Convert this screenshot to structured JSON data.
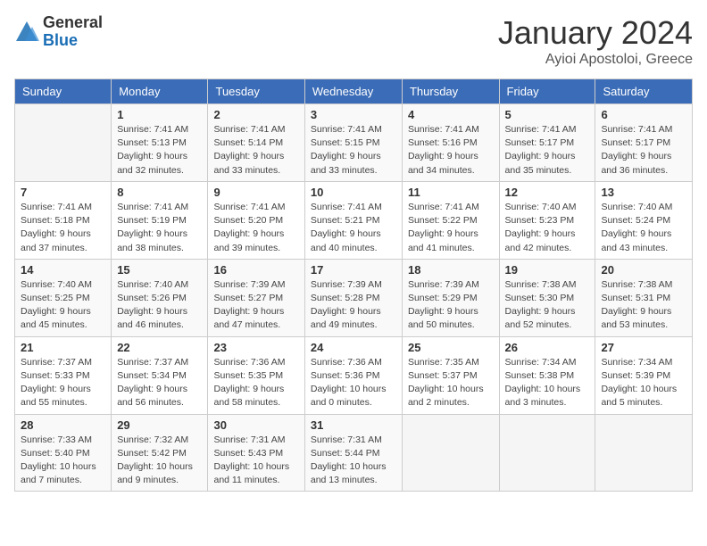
{
  "header": {
    "logo_general": "General",
    "logo_blue": "Blue",
    "title": "January 2024",
    "subtitle": "Ayioi Apostoloi, Greece"
  },
  "days_of_week": [
    "Sunday",
    "Monday",
    "Tuesday",
    "Wednesday",
    "Thursday",
    "Friday",
    "Saturday"
  ],
  "weeks": [
    [
      {
        "num": "",
        "info": ""
      },
      {
        "num": "1",
        "info": "Sunrise: 7:41 AM\nSunset: 5:13 PM\nDaylight: 9 hours\nand 32 minutes."
      },
      {
        "num": "2",
        "info": "Sunrise: 7:41 AM\nSunset: 5:14 PM\nDaylight: 9 hours\nand 33 minutes."
      },
      {
        "num": "3",
        "info": "Sunrise: 7:41 AM\nSunset: 5:15 PM\nDaylight: 9 hours\nand 33 minutes."
      },
      {
        "num": "4",
        "info": "Sunrise: 7:41 AM\nSunset: 5:16 PM\nDaylight: 9 hours\nand 34 minutes."
      },
      {
        "num": "5",
        "info": "Sunrise: 7:41 AM\nSunset: 5:17 PM\nDaylight: 9 hours\nand 35 minutes."
      },
      {
        "num": "6",
        "info": "Sunrise: 7:41 AM\nSunset: 5:17 PM\nDaylight: 9 hours\nand 36 minutes."
      }
    ],
    [
      {
        "num": "7",
        "info": "Sunrise: 7:41 AM\nSunset: 5:18 PM\nDaylight: 9 hours\nand 37 minutes."
      },
      {
        "num": "8",
        "info": "Sunrise: 7:41 AM\nSunset: 5:19 PM\nDaylight: 9 hours\nand 38 minutes."
      },
      {
        "num": "9",
        "info": "Sunrise: 7:41 AM\nSunset: 5:20 PM\nDaylight: 9 hours\nand 39 minutes."
      },
      {
        "num": "10",
        "info": "Sunrise: 7:41 AM\nSunset: 5:21 PM\nDaylight: 9 hours\nand 40 minutes."
      },
      {
        "num": "11",
        "info": "Sunrise: 7:41 AM\nSunset: 5:22 PM\nDaylight: 9 hours\nand 41 minutes."
      },
      {
        "num": "12",
        "info": "Sunrise: 7:40 AM\nSunset: 5:23 PM\nDaylight: 9 hours\nand 42 minutes."
      },
      {
        "num": "13",
        "info": "Sunrise: 7:40 AM\nSunset: 5:24 PM\nDaylight: 9 hours\nand 43 minutes."
      }
    ],
    [
      {
        "num": "14",
        "info": "Sunrise: 7:40 AM\nSunset: 5:25 PM\nDaylight: 9 hours\nand 45 minutes."
      },
      {
        "num": "15",
        "info": "Sunrise: 7:40 AM\nSunset: 5:26 PM\nDaylight: 9 hours\nand 46 minutes."
      },
      {
        "num": "16",
        "info": "Sunrise: 7:39 AM\nSunset: 5:27 PM\nDaylight: 9 hours\nand 47 minutes."
      },
      {
        "num": "17",
        "info": "Sunrise: 7:39 AM\nSunset: 5:28 PM\nDaylight: 9 hours\nand 49 minutes."
      },
      {
        "num": "18",
        "info": "Sunrise: 7:39 AM\nSunset: 5:29 PM\nDaylight: 9 hours\nand 50 minutes."
      },
      {
        "num": "19",
        "info": "Sunrise: 7:38 AM\nSunset: 5:30 PM\nDaylight: 9 hours\nand 52 minutes."
      },
      {
        "num": "20",
        "info": "Sunrise: 7:38 AM\nSunset: 5:31 PM\nDaylight: 9 hours\nand 53 minutes."
      }
    ],
    [
      {
        "num": "21",
        "info": "Sunrise: 7:37 AM\nSunset: 5:33 PM\nDaylight: 9 hours\nand 55 minutes."
      },
      {
        "num": "22",
        "info": "Sunrise: 7:37 AM\nSunset: 5:34 PM\nDaylight: 9 hours\nand 56 minutes."
      },
      {
        "num": "23",
        "info": "Sunrise: 7:36 AM\nSunset: 5:35 PM\nDaylight: 9 hours\nand 58 minutes."
      },
      {
        "num": "24",
        "info": "Sunrise: 7:36 AM\nSunset: 5:36 PM\nDaylight: 10 hours\nand 0 minutes."
      },
      {
        "num": "25",
        "info": "Sunrise: 7:35 AM\nSunset: 5:37 PM\nDaylight: 10 hours\nand 2 minutes."
      },
      {
        "num": "26",
        "info": "Sunrise: 7:34 AM\nSunset: 5:38 PM\nDaylight: 10 hours\nand 3 minutes."
      },
      {
        "num": "27",
        "info": "Sunrise: 7:34 AM\nSunset: 5:39 PM\nDaylight: 10 hours\nand 5 minutes."
      }
    ],
    [
      {
        "num": "28",
        "info": "Sunrise: 7:33 AM\nSunset: 5:40 PM\nDaylight: 10 hours\nand 7 minutes."
      },
      {
        "num": "29",
        "info": "Sunrise: 7:32 AM\nSunset: 5:42 PM\nDaylight: 10 hours\nand 9 minutes."
      },
      {
        "num": "30",
        "info": "Sunrise: 7:31 AM\nSunset: 5:43 PM\nDaylight: 10 hours\nand 11 minutes."
      },
      {
        "num": "31",
        "info": "Sunrise: 7:31 AM\nSunset: 5:44 PM\nDaylight: 10 hours\nand 13 minutes."
      },
      {
        "num": "",
        "info": ""
      },
      {
        "num": "",
        "info": ""
      },
      {
        "num": "",
        "info": ""
      }
    ]
  ]
}
